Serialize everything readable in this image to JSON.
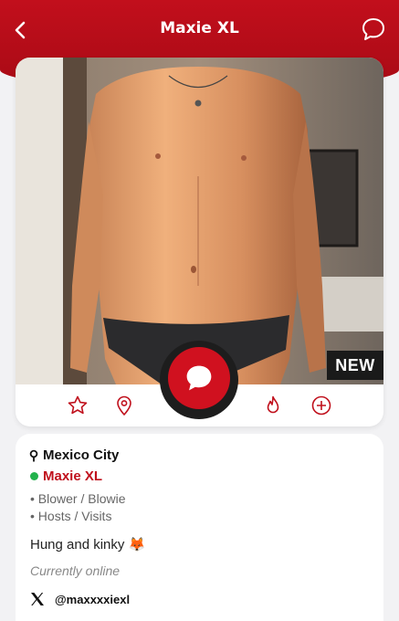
{
  "header": {
    "title": "Maxie XL",
    "back_icon": "chevron-left-icon",
    "chat_icon": "chat-bubble-icon",
    "background_color": "#b50d19"
  },
  "profile": {
    "badge": "NEW",
    "actions": {
      "favorite_icon": "star-icon",
      "location_icon": "map-pin-icon",
      "message_icon": "chat-bubble-icon",
      "hot_icon": "flame-icon",
      "add_icon": "plus-circle-icon"
    },
    "location": "Mexico City",
    "name": "Maxie XL",
    "online_color": "#22b24c",
    "preferences": [
      "• Blower / Blowie",
      "• Hosts / Visits"
    ],
    "bio": "Hung and kinky",
    "bio_emoji": "🦊",
    "status": "Currently online",
    "social": {
      "platform_icon": "x-logo-icon",
      "handle": "@maxxxxiexl"
    }
  },
  "colors": {
    "accent": "#c0101c"
  }
}
